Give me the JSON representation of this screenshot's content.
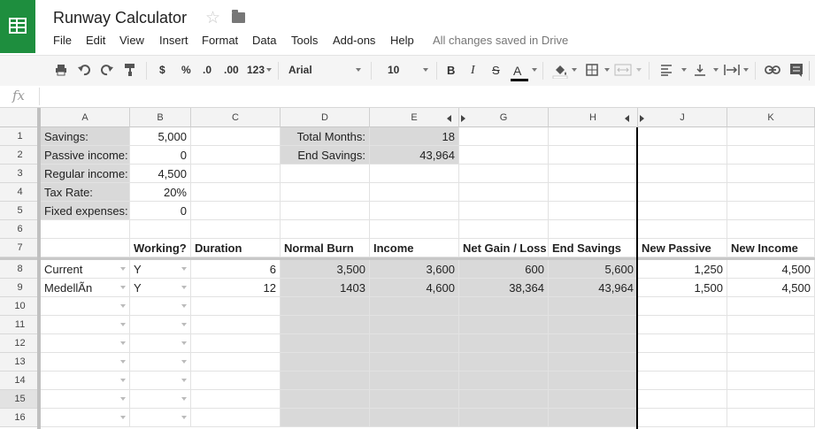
{
  "doc": {
    "title": "Runway Calculator",
    "status": "All changes saved in Drive"
  },
  "menu": [
    "File",
    "Edit",
    "View",
    "Insert",
    "Format",
    "Data",
    "Tools",
    "Add-ons",
    "Help"
  ],
  "toolbar": {
    "currency": "$",
    "percent": "%",
    "dec_less": ".0",
    "dec_more": ".00",
    "more_formats": "123",
    "font": "Arial",
    "size": "10",
    "bold": "B",
    "italic": "I",
    "strike": "S",
    "textcolor": "A"
  },
  "formula_bar": {
    "label": "fx",
    "value": ""
  },
  "columns": [
    "A",
    "B",
    "C",
    "D",
    "E",
    "G",
    "H",
    "J",
    "K"
  ],
  "rows": [
    "1",
    "2",
    "3",
    "4",
    "5",
    "6",
    "7",
    "8",
    "9",
    "10",
    "11",
    "12",
    "13",
    "14",
    "15",
    "16"
  ],
  "cells": {
    "a1": "Savings:",
    "b1": "5,000",
    "d1": "Total Months:",
    "e1": "18",
    "a2": "Passive income:",
    "b2": "0",
    "d2": "End Savings:",
    "e2": "43,964",
    "a3": "Regular income:",
    "b3": "4,500",
    "a4": "Tax Rate:",
    "b4": "20%",
    "a5": "Fixed expenses:",
    "b5": "0",
    "b7": "Working?",
    "c7": "Duration",
    "d7": "Normal Burn",
    "e7": "Income",
    "g7": "Net Gain / Loss",
    "h7": "End Savings",
    "j7": "New Passive",
    "k7": "New Income",
    "a8": "Current",
    "b8": "Y",
    "c8": "6",
    "d8": "3,500",
    "e8": "3,600",
    "g8": "600",
    "h8": "5,600",
    "j8": "1,250",
    "k8": "4,500",
    "a9": "MedellÃn",
    "b9": "Y",
    "c9": "12",
    "d9": "1403",
    "e9": "4,600",
    "g9": "38,364",
    "h9": "43,964",
    "j9": "1,500",
    "k9": "4,500"
  },
  "colors": {
    "brand": "#1e8e3e",
    "shade": "#d9d9d9"
  }
}
